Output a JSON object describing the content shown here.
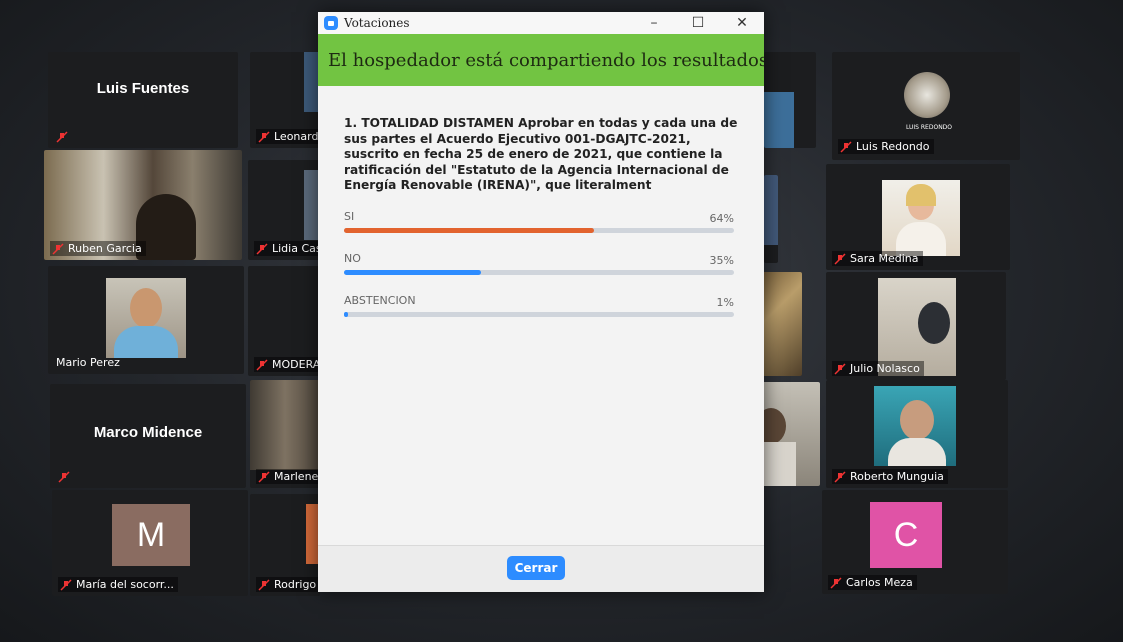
{
  "window": {
    "title": "Votaciones",
    "banner": "El hospedador está compartiendo los resultados de..."
  },
  "poll": {
    "question": "1. TOTALIDAD DISTAMEN Aprobar en todas y cada una de sus partes el Acuerdo Ejecutivo 001-DGAJTC-2021, suscrito en fecha 25 de enero de 2021, que contiene la ratificación del \"Estatuto de la Agencia Internacional de Energía Renovable (IRENA)\", que literalment",
    "options": [
      {
        "label": "SI",
        "percent_text": "64%",
        "fraction": 0.64,
        "color": "#e2632e"
      },
      {
        "label": "NO",
        "percent_text": "35%",
        "fraction": 0.35,
        "color": "#2d8cff"
      },
      {
        "label": "ABSTENCION",
        "percent_text": "1%",
        "fraction": 0.01,
        "color": "#2d8cff"
      }
    ],
    "close_label": "Cerrar"
  },
  "participants": {
    "luis_fuentes": "Luis Fuentes",
    "leonard": "Leonard",
    "luis_redondo": "Luis Redondo",
    "luis_redondo_logo": "LUIS REDONDO",
    "ruben": "Ruben Garcia",
    "lidia": "Lidia Cas",
    "sara": "Sara Medina",
    "mario": "Mario Perez",
    "modera": "MODERA",
    "julio": "Julio Nolasco",
    "marco": "Marco Midence",
    "marlene": "Marlene",
    "roberto": "Roberto Munguia",
    "maria": "María del socorr...",
    "maria_initial": "M",
    "rodrigo": "Rodrigo",
    "carlos": "Carlos Meza",
    "carlos_initial": "C"
  }
}
